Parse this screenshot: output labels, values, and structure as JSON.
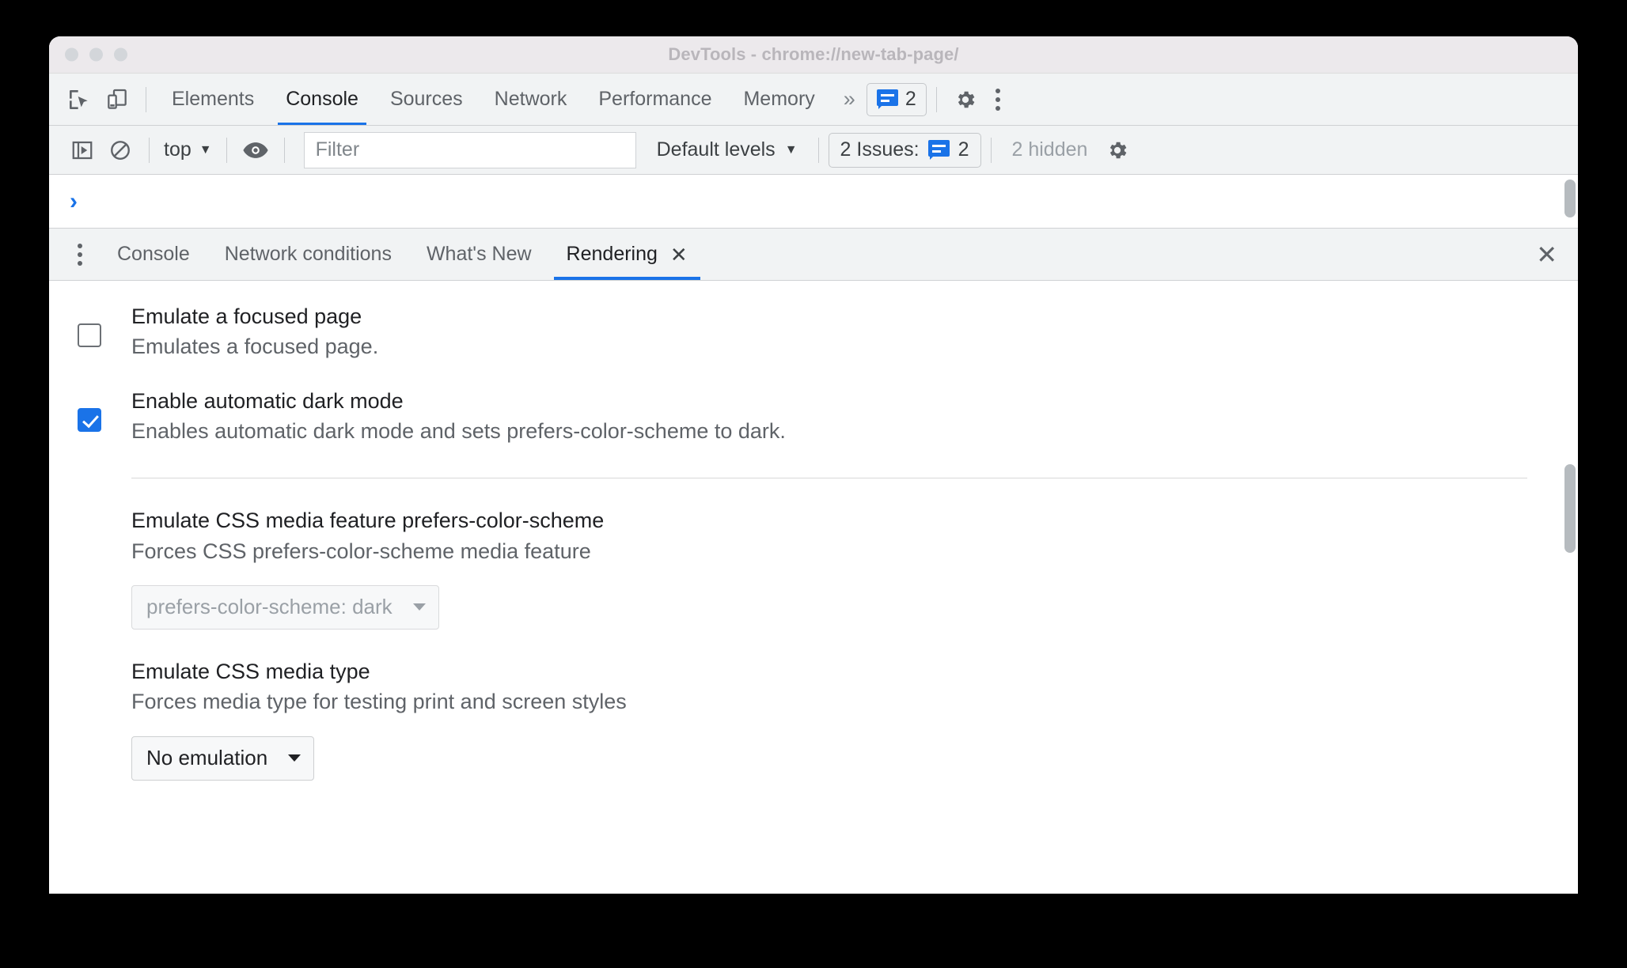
{
  "window": {
    "title": "DevTools - chrome://new-tab-page/"
  },
  "main_tabbar": {
    "icons": {
      "inspect": "inspect-element-icon",
      "device": "device-toolbar-icon",
      "more_tabs": "»",
      "settings": "gear-icon",
      "menu": "kebab-menu-icon"
    },
    "tabs": [
      {
        "label": "Elements",
        "active": false
      },
      {
        "label": "Console",
        "active": true
      },
      {
        "label": "Sources",
        "active": false
      },
      {
        "label": "Network",
        "active": false
      },
      {
        "label": "Performance",
        "active": false
      },
      {
        "label": "Memory",
        "active": false
      }
    ],
    "issues_count": "2"
  },
  "console_toolbar": {
    "sidebar_toggle": "console-sidebar-icon",
    "clear_console": "clear-console-icon",
    "context": "top",
    "context_caret": "▼",
    "eye": "live-expression-icon",
    "filter_placeholder": "Filter",
    "filter_value": "",
    "levels": "Default levels",
    "levels_caret": "▼",
    "issues_label": "2 Issues:",
    "issues_count": "2",
    "hidden_label": "2 hidden",
    "settings": "gear-icon"
  },
  "console_output": {
    "prompt": "›"
  },
  "drawer": {
    "menu_icon": "kebab-menu-icon",
    "tabs": [
      {
        "label": "Console",
        "active": false,
        "closeable": false
      },
      {
        "label": "Network conditions",
        "active": false,
        "closeable": false
      },
      {
        "label": "What's New",
        "active": false,
        "closeable": false
      },
      {
        "label": "Rendering",
        "active": true,
        "closeable": true,
        "close_glyph": "✕"
      }
    ],
    "close_glyph": "✕"
  },
  "rendering": {
    "checkboxes": [
      {
        "title": "Emulate a focused page",
        "desc": "Emulates a focused page.",
        "checked": false
      },
      {
        "title": "Enable automatic dark mode",
        "desc": "Enables automatic dark mode and sets prefers-color-scheme to dark.",
        "checked": true
      }
    ],
    "groups": [
      {
        "title": "Emulate CSS media feature prefers-color-scheme",
        "desc": "Forces CSS prefers-color-scheme media feature",
        "select_value": "prefers-color-scheme: dark",
        "disabled": true
      },
      {
        "title": "Emulate CSS media type",
        "desc": "Forces media type for testing print and screen styles",
        "select_value": "No emulation",
        "disabled": false
      }
    ]
  },
  "colors": {
    "accent": "#1a73e8",
    "toolbar_bg": "#f1f3f4",
    "titlebar_bg": "#ece9ec",
    "text": "#202124",
    "muted": "#5f6368"
  }
}
